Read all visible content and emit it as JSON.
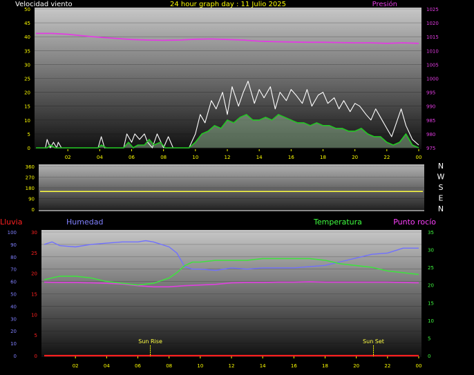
{
  "header": {
    "left": "Velocidad viento",
    "center": "24 hour graph day : 11 Julio 2025",
    "right": "Presión"
  },
  "colors": {
    "background": "#000000",
    "axis_text": "#ffff00",
    "pressure": "#e23ce2",
    "wind_gust": "#ffffff",
    "wind_speed": "#22c722",
    "wind_speed_fill": "#c8ffc8",
    "direction": "#ffff40",
    "humidity": "#7070ff",
    "temperature": "#40e040",
    "dewpoint": "#e040e0",
    "rain": "#ff2020",
    "left_label": "#ff2020",
    "humidity_label": "#8080ff",
    "temperature_label": "#40ff40",
    "dewpoint_label": "#ff40ff",
    "direction_letters": "#ffffff"
  },
  "chart_data": [
    {
      "type": "line",
      "name": "wind-pressure",
      "x_ticks": [
        "02",
        "04",
        "06",
        "08",
        "10",
        "12",
        "14",
        "16",
        "18",
        "20",
        "22",
        "00"
      ],
      "y_left_ticks": [
        "0",
        "5",
        "10",
        "15",
        "20",
        "25",
        "30",
        "35",
        "40",
        "45",
        "50"
      ],
      "y_left_range": [
        0,
        50
      ],
      "y_right_ticks": [
        "975",
        "980",
        "985",
        "990",
        "995",
        "1000",
        "1005",
        "1010",
        "1015",
        "1020",
        "1025"
      ],
      "y_right_range": [
        975,
        1025
      ],
      "pressure_series": {
        "x": [
          0,
          1,
          2,
          3,
          4,
          5,
          6,
          7,
          8,
          9,
          10,
          11,
          12,
          13,
          14,
          15,
          16,
          17,
          18,
          19,
          20,
          21,
          22,
          23,
          24
        ],
        "values": [
          1016.2,
          1016.2,
          1015.9,
          1015.3,
          1014.8,
          1014.4,
          1014.0,
          1013.8,
          1013.7,
          1013.8,
          1014.1,
          1014.2,
          1014.0,
          1013.8,
          1013.4,
          1013.2,
          1013.1,
          1013.0,
          1013.0,
          1012.9,
          1012.8,
          1012.8,
          1012.6,
          1012.8,
          1012.6
        ]
      },
      "wind_gust": {
        "x": [
          0,
          0.6,
          0.7,
          0.9,
          1.1,
          1.3,
          1.4,
          1.6,
          3.9,
          4.1,
          4.3,
          5.5,
          5.7,
          6.0,
          6.2,
          6.5,
          6.8,
          7.0,
          7.3,
          7.6,
          8.0,
          8.3,
          8.6,
          9.6,
          10.0,
          10.3,
          10.6,
          11.0,
          11.3,
          11.7,
          12.0,
          12.3,
          12.7,
          13.0,
          13.3,
          13.7,
          14.0,
          14.3,
          14.7,
          15.0,
          15.3,
          15.7,
          16.0,
          16.3,
          16.7,
          17.0,
          17.3,
          17.7,
          18.0,
          18.3,
          18.7,
          19.0,
          19.3,
          19.7,
          20.0,
          20.3,
          20.7,
          21.0,
          21.3,
          21.7,
          22.0,
          22.3,
          22.6,
          22.9,
          23.2,
          23.6,
          24.0
        ],
        "values": [
          0,
          0,
          3,
          0,
          2,
          0,
          2,
          0,
          0,
          4,
          0,
          0,
          5,
          2,
          5,
          3,
          5,
          2,
          0,
          5,
          0,
          4,
          0,
          0,
          5,
          12,
          9,
          17,
          14,
          20,
          12,
          22,
          15,
          20,
          24,
          16,
          21,
          18,
          22,
          14,
          20,
          17,
          21,
          19,
          16,
          21,
          15,
          19,
          20,
          16,
          18,
          14,
          17,
          13,
          16,
          15,
          12,
          10,
          14,
          10,
          7,
          4,
          9,
          14,
          8,
          3,
          1
        ]
      },
      "wind_speed": {
        "x": [
          0,
          0.7,
          0.9,
          1.2,
          1.5,
          3.9,
          4.1,
          4.4,
          5.5,
          5.8,
          6.1,
          6.4,
          6.8,
          7.1,
          7.4,
          7.8,
          8.1,
          8.6,
          9.6,
          10.0,
          10.4,
          10.8,
          11.2,
          11.6,
          12.0,
          12.4,
          12.8,
          13.2,
          13.6,
          14.0,
          14.4,
          14.8,
          15.2,
          15.6,
          16.0,
          16.4,
          16.8,
          17.2,
          17.6,
          18.0,
          18.4,
          18.8,
          19.2,
          19.6,
          20.0,
          20.4,
          20.8,
          21.2,
          21.6,
          22.0,
          22.4,
          22.8,
          23.2,
          23.6,
          24.0
        ],
        "values": [
          0,
          0,
          1,
          0,
          0,
          0,
          1,
          0,
          0,
          2,
          0,
          1,
          1,
          3,
          1,
          2,
          0,
          0,
          0,
          2,
          5,
          6,
          8,
          7,
          10,
          9,
          11,
          12,
          10,
          10,
          11,
          10,
          12,
          11,
          10,
          9,
          9,
          8,
          9,
          8,
          8,
          7,
          7,
          6,
          6,
          7,
          5,
          4,
          4,
          2,
          1,
          2,
          5,
          1,
          0
        ]
      }
    },
    {
      "type": "line",
      "name": "wind-direction",
      "y_ticks": [
        "0",
        "90",
        "180",
        "270",
        "360"
      ],
      "y_range": [
        0,
        360
      ],
      "direction_letters": [
        "N",
        "W",
        "S",
        "E",
        "N"
      ],
      "series": {
        "x": [
          0,
          24
        ],
        "values": [
          150,
          150
        ]
      }
    },
    {
      "type": "line",
      "name": "temp-humidity",
      "x_ticks": [
        "02",
        "04",
        "06",
        "08",
        "10",
        "12",
        "14",
        "16",
        "18",
        "20",
        "22",
        "00"
      ],
      "labels": {
        "left": "Lluvia",
        "humidity": "Humedad",
        "temperature": "Temperatura",
        "dewpoint": "Punto rocío"
      },
      "humidity_ticks": [
        "0",
        "10",
        "20",
        "30",
        "40",
        "50",
        "60",
        "70",
        "80",
        "90",
        "100"
      ],
      "humidity_range": [
        0,
        100
      ],
      "rain_ticks": [
        "0",
        "5",
        "10",
        "15",
        "20",
        "25",
        "30"
      ],
      "rain_range": [
        0,
        30
      ],
      "temp_ticks": [
        "0",
        "5",
        "10",
        "15",
        "20",
        "25",
        "30",
        "35"
      ],
      "temp_range": [
        0,
        35
      ],
      "annotations": [
        {
          "text": "Sun Rise",
          "x": 6.8
        },
        {
          "text": "Sun Set",
          "x": 21.1
        }
      ],
      "humidity": {
        "x": [
          0,
          0.5,
          1,
          2,
          3,
          4,
          5,
          6,
          6.5,
          7,
          8,
          8.5,
          9,
          9.5,
          10,
          11,
          12,
          13,
          14,
          15,
          16,
          17,
          18,
          19,
          20,
          21,
          22,
          23,
          24
        ],
        "values": [
          90,
          92,
          89,
          88,
          90,
          91,
          92,
          92,
          93,
          92,
          88,
          83,
          72,
          70,
          70,
          69,
          71,
          70,
          71,
          71,
          71,
          72,
          73,
          76,
          79,
          82,
          83,
          87,
          87
        ]
      },
      "temperature": {
        "x": [
          0,
          1,
          2,
          3,
          4,
          5,
          6,
          7,
          8,
          8.5,
          9,
          9.5,
          10,
          11,
          12,
          13,
          14,
          15,
          16,
          17,
          18,
          19,
          20,
          21,
          22,
          23,
          24
        ],
        "values": [
          21.5,
          22.5,
          22.5,
          22.0,
          21.0,
          20.5,
          20.0,
          20.5,
          22.0,
          23.5,
          25.5,
          26.5,
          26.5,
          27.0,
          27.0,
          27.0,
          27.5,
          27.5,
          27.5,
          27.5,
          27.0,
          26.0,
          25.5,
          25.0,
          24.0,
          23.5,
          23.0
        ]
      },
      "dewpoint": {
        "x": [
          0,
          1,
          2,
          3,
          4,
          5,
          6,
          7,
          8,
          9,
          10,
          11,
          12,
          13,
          14,
          15,
          16,
          17,
          18,
          19,
          20,
          21,
          22,
          23,
          24
        ],
        "values": [
          20.8,
          20.7,
          20.7,
          20.6,
          20.5,
          20.3,
          19.8,
          19.5,
          19.5,
          19.8,
          20.0,
          20.2,
          20.6,
          20.7,
          20.7,
          20.8,
          20.8,
          20.9,
          20.8,
          20.8,
          20.8,
          20.8,
          20.8,
          20.7,
          20.6
        ]
      },
      "rain": {
        "x": [
          0,
          24
        ],
        "values": [
          0,
          0
        ]
      }
    }
  ]
}
